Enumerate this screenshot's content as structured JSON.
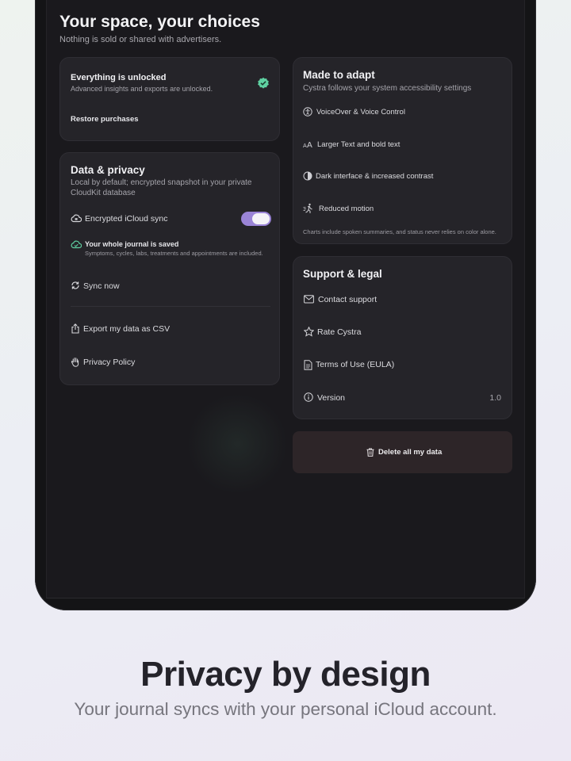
{
  "header": {
    "title": "Your space, your choices",
    "subtitle": "Nothing is sold or shared with advertisers."
  },
  "unlock_card": {
    "title": "Everything is unlocked",
    "subtitle": "Advanced insights and exports are unlocked.",
    "restore_label": "Restore purchases"
  },
  "privacy_card": {
    "title": "Data & privacy",
    "subtitle": "Local by default; encrypted snapshot in your private CloudKit database",
    "sync_label": "Encrypted iCloud sync",
    "sync_enabled": true,
    "saved_title": "Your whole journal is saved",
    "saved_detail": "Symptoms, cycles, labs, treatments and appointments are included.",
    "sync_now_label": "Sync now",
    "export_label": "Export my data as CSV",
    "policy_label": "Privacy Policy"
  },
  "adapt_card": {
    "title": "Made to adapt",
    "subtitle": "Cystra follows your system accessibility settings",
    "items": [
      {
        "icon": "accessibility-icon",
        "label": "VoiceOver & Voice Control"
      },
      {
        "icon": "text-size-icon",
        "label": "Larger Text and bold text"
      },
      {
        "icon": "contrast-icon",
        "label": "Dark interface & increased contrast"
      },
      {
        "icon": "motion-icon",
        "label": "Reduced motion"
      }
    ],
    "footnote": "Charts include spoken summaries, and status never relies on color alone."
  },
  "support_card": {
    "title": "Support & legal",
    "contact_label": "Contact support",
    "rate_label": "Rate Cystra",
    "terms_label": "Terms of Use (EULA)",
    "version_label": "Version",
    "version_value": "1.0"
  },
  "delete_label": "Delete all my data",
  "footer": {
    "title": "Privacy by design",
    "subtitle": "Your journal syncs with your personal iCloud account."
  },
  "colors": {
    "accent": "#9a84d6",
    "success": "#5fd1a2",
    "background": "#1a191d",
    "card": "#252429"
  }
}
